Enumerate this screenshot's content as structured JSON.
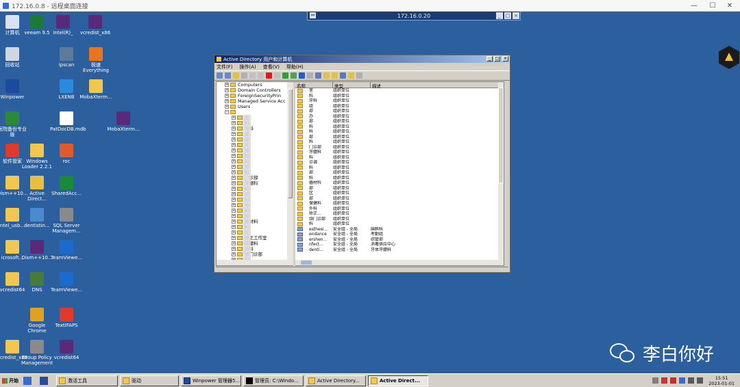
{
  "outer_window": {
    "title": "172.16.0.8 - 远程桌面连接",
    "controls": [
      "—",
      "☐",
      "✕"
    ]
  },
  "rdp_bar": {
    "host": "172.16.0.20"
  },
  "desktop_icons": [
    {
      "label": "计算机",
      "color": "#d9e3f0"
    },
    {
      "label": "veeam 9.5",
      "color": "#1b7a3a"
    },
    {
      "label": "Intel(R)_",
      "color": "#5a2a7a"
    },
    {
      "label": "vcredist_x86",
      "color": "#5a2a7a"
    },
    {
      "label": "回收站",
      "color": "#cfd8e0"
    },
    {
      "label": "ipscan",
      "color": "#5e7a9a"
    },
    {
      "label": "极速 Everything",
      "color": "#e8741c"
    },
    {
      "label": "Winpower",
      "color": "#1a4c9c"
    },
    {
      "label": "LXENB",
      "color": "#2a8adc"
    },
    {
      "label": "MobaXterm...",
      "color": "#f0c850"
    },
    {
      "label": "医院备份专业版",
      "color": "#2a8a3a"
    },
    {
      "label": "PatDocDB.mdb",
      "color": "#ffffff"
    },
    {
      "label": "MobaXterm...",
      "color": "#5a2a7a"
    },
    {
      "label": "软件管家",
      "color": "#e03a2a"
    },
    {
      "label": "Windows Loader 2.2.1",
      "color": "#f0c850"
    },
    {
      "label": "roc",
      "color": "#e05a2a"
    },
    {
      "label": "Dism++10...",
      "color": "#f0c850"
    },
    {
      "label": "Active Direct...",
      "color": "#e8c040"
    },
    {
      "label": "SharedAcc...",
      "color": "#1a8a3a"
    },
    {
      "label": "ntel_usb...",
      "color": "#f0c850"
    },
    {
      "label": "dentistin...",
      "color": "#4a8ad0"
    },
    {
      "label": "SQL Server Managem...",
      "color": "#8a8a8a"
    },
    {
      "label": "icrosoft...",
      "color": "#f0c850"
    },
    {
      "label": "Dism++10...",
      "color": "#5a2a7a"
    },
    {
      "label": "TeamViewe...",
      "color": "#1a6ad0"
    },
    {
      "label": "vcredist64",
      "color": "#f0c850"
    },
    {
      "label": "DNS",
      "color": "#4a7a3a"
    },
    {
      "label": "TeamViewe...",
      "color": "#1a6ad0"
    },
    {
      "label": "Google Chrome",
      "color": "#e0a020"
    },
    {
      "label": "TextIFAPS",
      "color": "#e03a2a"
    },
    {
      "label": "vcredist_x86",
      "color": "#f0c850"
    },
    {
      "label": "Group Policy Management",
      "color": "#8a8a8a"
    },
    {
      "label": "vcredist64",
      "color": "#5a2a7a"
    }
  ],
  "ad_window": {
    "title": "Active Directory 用户和计算机",
    "menu": [
      "文件(F)",
      "操作(A)",
      "查看(V)",
      "帮助(H)"
    ],
    "tree": [
      {
        "label": "Computers",
        "indent": 1
      },
      {
        "label": "Domain Controllers",
        "indent": 1
      },
      {
        "label": "ForeignSecurityPrin",
        "indent": 1
      },
      {
        "label": "Managed Service Acc",
        "indent": 1
      },
      {
        "label": "Users",
        "indent": 1
      },
      {
        "label": "",
        "indent": 1
      },
      {
        "label": "室",
        "indent": 2
      },
      {
        "label": "料",
        "indent": 2
      },
      {
        "label": "牙科",
        "indent": 2
      },
      {
        "label": "组",
        "indent": 2
      },
      {
        "label": "部",
        "indent": 2
      },
      {
        "label": "公",
        "indent": 2
      },
      {
        "label": "部",
        "indent": 2
      },
      {
        "label": "料",
        "indent": 2
      },
      {
        "label": "科",
        "indent": 2
      },
      {
        "label": "部",
        "indent": 2
      },
      {
        "label": "料",
        "indent": 2
      },
      {
        "label": "门诊部",
        "indent": 2
      },
      {
        "label": "牙髓科",
        "indent": 2
      },
      {
        "label": "料",
        "indent": 2
      },
      {
        "label": "调",
        "indent": 2
      },
      {
        "label": "料",
        "indent": 2
      },
      {
        "label": "部",
        "indent": 2
      },
      {
        "label": "料",
        "indent": 2
      },
      {
        "label": "部",
        "indent": 2
      },
      {
        "label": "器材料",
        "indent": 2
      },
      {
        "label": "料",
        "indent": 2
      },
      {
        "label": "区",
        "indent": 2
      },
      {
        "label": "矫正工作室",
        "indent": 2
      },
      {
        "label": "保健料",
        "indent": 2
      },
      {
        "label": "外科",
        "indent": 2
      },
      {
        "label": "颌门诊部",
        "indent": 2
      },
      {
        "label": "料",
        "indent": 2
      }
    ],
    "columns": [
      "名称",
      "类型",
      "描述"
    ],
    "rows": [
      {
        "name": "室",
        "type": "组织单位",
        "desc": ""
      },
      {
        "name": "料",
        "type": "组织单位",
        "desc": ""
      },
      {
        "name": "牙科",
        "type": "组织单位",
        "desc": ""
      },
      {
        "name": "组",
        "type": "组织单位",
        "desc": ""
      },
      {
        "name": "部",
        "type": "组织单位",
        "desc": ""
      },
      {
        "name": "办",
        "type": "组织单位",
        "desc": ""
      },
      {
        "name": "部",
        "type": "组织单位",
        "desc": ""
      },
      {
        "name": "料",
        "type": "组织单位",
        "desc": ""
      },
      {
        "name": "科",
        "type": "组织单位",
        "desc": ""
      },
      {
        "name": "部",
        "type": "组织单位",
        "desc": ""
      },
      {
        "name": "料",
        "type": "组织单位",
        "desc": ""
      },
      {
        "name": "门诊部",
        "type": "组织单位",
        "desc": ""
      },
      {
        "name": "牙髓科",
        "type": "组织单位",
        "desc": ""
      },
      {
        "name": "料",
        "type": "组织单位",
        "desc": ""
      },
      {
        "name": "诊调",
        "type": "组织单位",
        "desc": ""
      },
      {
        "name": "料",
        "type": "组织单位",
        "desc": ""
      },
      {
        "name": "部",
        "type": "组织单位",
        "desc": ""
      },
      {
        "name": "料",
        "type": "组织单位",
        "desc": ""
      },
      {
        "name": "器材料",
        "type": "组织单位",
        "desc": ""
      },
      {
        "name": "部",
        "type": "组织单位",
        "desc": ""
      },
      {
        "name": "区",
        "type": "组织单位",
        "desc": ""
      },
      {
        "name": "部",
        "type": "组织单位",
        "desc": ""
      },
      {
        "name": "保健料",
        "type": "组织单位",
        "desc": ""
      },
      {
        "name": "外科",
        "type": "组织单位",
        "desc": ""
      },
      {
        "name": "矫正...",
        "type": "组织单位",
        "desc": ""
      },
      {
        "name": "颌门诊部",
        "type": "组织单位",
        "desc": ""
      },
      {
        "name": "料",
        "type": "组织单位",
        "desc": ""
      },
      {
        "name": "esthesi...",
        "type": "安全组 - 全局",
        "desc": "麻醉科"
      },
      {
        "name": "endance",
        "type": "安全组 - 全局",
        "desc": "考勤组"
      },
      {
        "name": "ershen...",
        "type": "安全组 - 全局",
        "desc": "综管部"
      },
      {
        "name": "nfect...",
        "type": "安全组 - 全局",
        "desc": "消毒供应中心"
      },
      {
        "name": "denti...",
        "type": "安全组 - 全局",
        "desc": "牙体牙髓科"
      }
    ]
  },
  "taskbar": {
    "start": "开始",
    "items": [
      {
        "label": "激活工具",
        "active": false
      },
      {
        "label": "驱动",
        "active": false
      },
      {
        "label": "Winpower 管理器5...",
        "active": false
      },
      {
        "label": "管理员: C:\\Windo...",
        "active": false
      },
      {
        "label": "Active Directory...",
        "active": false
      },
      {
        "label": "Active Direct...",
        "active": true
      }
    ],
    "time": "15:51",
    "date": "2023-01-01"
  },
  "watermark": "李白你好"
}
